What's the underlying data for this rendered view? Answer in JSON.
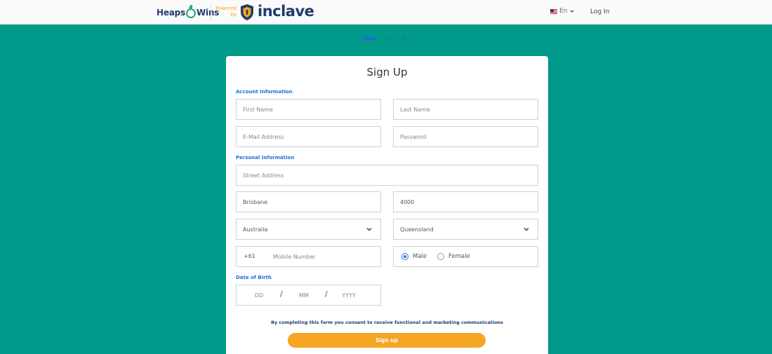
{
  "header": {
    "logo": "Heaps o Wins",
    "logo_left": "Heaps",
    "logo_right": "Wins",
    "powered_line1": "Powered",
    "powered_line2": "by",
    "brand": "inclave",
    "language": "En",
    "login": "Log In"
  },
  "steps": {
    "current": 1,
    "total": 3
  },
  "form": {
    "title": "Sign Up",
    "sections": {
      "account": "Account Information",
      "personal": "Personal Information",
      "dob": "Date of Birth"
    },
    "fields": {
      "first_name": {
        "placeholder": "First Name",
        "value": ""
      },
      "last_name": {
        "placeholder": "Last Name",
        "value": ""
      },
      "email": {
        "placeholder": "E-Mail Address",
        "value": ""
      },
      "password": {
        "placeholder": "Password",
        "value": ""
      },
      "street": {
        "placeholder": "Street Address",
        "value": ""
      },
      "city": {
        "value": "Brisbane"
      },
      "postcode": {
        "value": "4000"
      },
      "country": {
        "value": "Australia"
      },
      "state": {
        "value": "Queensland"
      },
      "phone_prefix": "+61",
      "phone": {
        "placeholder": "Mobile Number",
        "value": ""
      },
      "gender": {
        "options": [
          "Male",
          "Female"
        ],
        "selected": "Male"
      },
      "dob_day": {
        "placeholder": "DD"
      },
      "dob_month": {
        "placeholder": "MM"
      },
      "dob_year": {
        "placeholder": "YYYY"
      },
      "dob_separator": "/"
    },
    "consent": "By completing this form you consent to receive functional and marketing communications",
    "submit": "Sign up"
  },
  "colors": {
    "background": "#00998a",
    "accent_blue": "#1e6fd9",
    "button_orange": "#f5a623",
    "brand_navy": "#1f3c6e"
  },
  "icons": {
    "shield": "shield-icon",
    "flag": "us-flag-icon",
    "chevron": "chevron-down-icon"
  }
}
